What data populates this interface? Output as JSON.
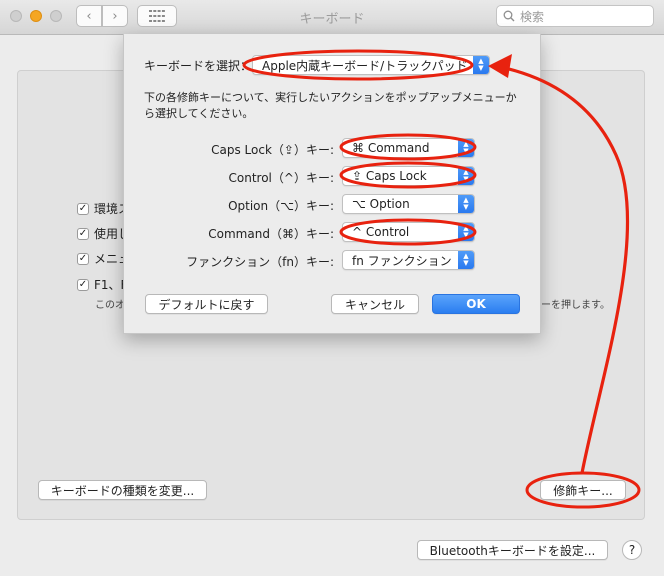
{
  "window": {
    "title": "キーボード",
    "search_placeholder": "検索",
    "back_glyph": "‹",
    "forward_glyph": "›"
  },
  "background": {
    "checkboxes": [
      {
        "label": "環境ス",
        "checked": true
      },
      {
        "label": "使用し",
        "checked": true
      },
      {
        "label": "メニュ",
        "checked": true
      },
      {
        "label": "F1、F",
        "checked": true
      }
    ],
    "note_left": "このオ",
    "note_right": "ーを押します。",
    "change_type_button": "キーボードの種類を変更...",
    "modifier_keys_button": "修飾キー...",
    "bluetooth_button": "Bluetoothキーボードを設定...",
    "help_button": "?"
  },
  "sheet": {
    "select_label": "キーボードを選択：",
    "selected_keyboard": "Apple内蔵キーボード/トラックパッド",
    "description": "下の各修飾キーについて、実行したいアクションをポップアップメニューから選択してください。",
    "rows": [
      {
        "label": "Caps Lock（⇪）キー:",
        "value": "⌘ Command"
      },
      {
        "label": "Control（^）キー:",
        "value": "⇪ Caps Lock"
      },
      {
        "label": "Option（⌥）キー:",
        "value": "⌥ Option"
      },
      {
        "label": "Command（⌘）キー:",
        "value": "^ Control"
      },
      {
        "label": "ファンクション（fn）キー:",
        "value": "fn ファンクション"
      }
    ],
    "restore_defaults_button": "デフォルトに戻す",
    "cancel_button": "キャンセル",
    "ok_button": "OK"
  },
  "colors": {
    "annotation_red": "#e8220f",
    "accent_blue": "#2b7ef0"
  }
}
